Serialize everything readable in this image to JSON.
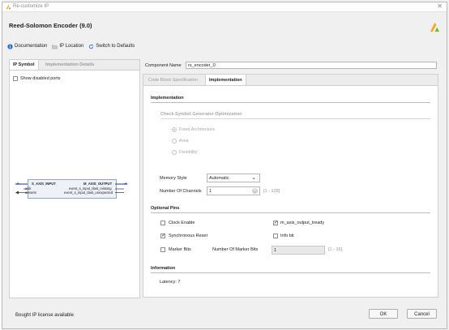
{
  "window": {
    "title": "Re-customize IP",
    "close_icon": "close-icon"
  },
  "header": {
    "title": "Reed-Solomon Encoder (9.0)"
  },
  "toolbar": {
    "documentation": "Documentation",
    "ip_location": "IP Location",
    "switch_defaults": "Switch to Defaults"
  },
  "left": {
    "tabs": [
      "IP Symbol",
      "Implementation Details"
    ],
    "show_disabled": "Show disabled ports",
    "symbol": {
      "left_ports": [
        "S_AXIS_INPUT",
        "aclk",
        "aresetn"
      ],
      "right_ports": [
        "M_AXIS_OUTPUT",
        "event_s_input_tlast_missing",
        "event_s_input_tlast_unexpected"
      ]
    }
  },
  "right": {
    "component_name_label": "Component Name",
    "component_name_value": "rs_encoder_0",
    "tabs": [
      "Code Block Specification",
      "Implementation"
    ],
    "implementation": {
      "section": "Implementation",
      "sub_section": "Check Symbol Generator Optimization",
      "radios": [
        {
          "label": "Fixed Architecture",
          "selected": true
        },
        {
          "label": "Area",
          "selected": false
        },
        {
          "label": "Flexibility",
          "selected": false
        }
      ],
      "memory_style_label": "Memory Style",
      "memory_style_value": "Automatic",
      "channels_label": "Number Of Channels",
      "channels_value": "1",
      "channels_range": "[1 - 128]"
    },
    "optional_pins": {
      "section": "Optional Pins",
      "clock_enable": {
        "label": "Clock Enable",
        "checked": false
      },
      "m_axis_tready": {
        "label": "m_axis_output_tready",
        "checked": true
      },
      "sync_reset": {
        "label": "Synchronous Reset",
        "checked": true
      },
      "info_bit": {
        "label": "Info bit",
        "checked": false
      },
      "marker_bits": {
        "label": "Marker Bits",
        "checked": false
      },
      "num_marker_label": "Number Of Marker Bits",
      "num_marker_value": "1",
      "num_marker_range": "[1 - 16]"
    },
    "information": {
      "section": "Information",
      "latency": "Latency: 7"
    }
  },
  "footer": {
    "license": "Bought IP license available",
    "ok": "OK",
    "cancel": "Cancel"
  },
  "colors": {
    "accent": "#2b6fd6",
    "logo": "#f0a81c",
    "bus_port": "#2e5ca8"
  }
}
